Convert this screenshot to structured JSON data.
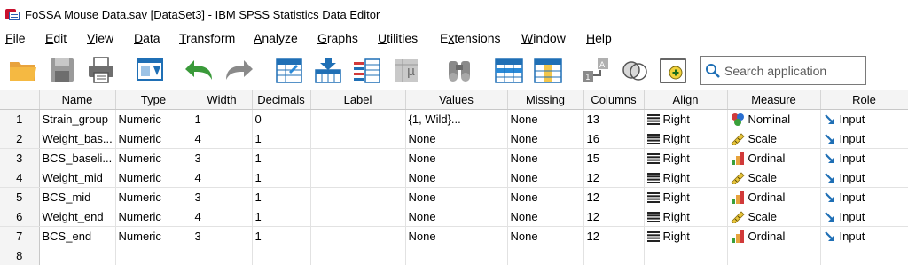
{
  "window": {
    "title": "FoSSA Mouse Data.sav [DataSet3] - IBM SPSS Statistics Data Editor"
  },
  "menu": [
    {
      "label": "File",
      "underline": "F",
      "rest": "ile"
    },
    {
      "label": "Edit",
      "underline": "E",
      "rest": "dit"
    },
    {
      "label": "View",
      "underline": "V",
      "rest": "iew"
    },
    {
      "label": "Data",
      "underline": "D",
      "rest": "ata"
    },
    {
      "label": "Transform",
      "underline": "T",
      "rest": "ransform"
    },
    {
      "label": "Analyze",
      "underline": "A",
      "rest": "nalyze"
    },
    {
      "label": "Graphs",
      "underline": "G",
      "rest": "raphs"
    },
    {
      "label": "Utilities",
      "underline": "U",
      "rest": "tilities"
    },
    {
      "label": "Extensions",
      "underline": "x",
      "pre": "E",
      "rest": "tensions"
    },
    {
      "label": "Window",
      "underline": "W",
      "rest": "indow"
    },
    {
      "label": "Help",
      "underline": "H",
      "rest": "elp"
    }
  ],
  "toolbar": {
    "icons": [
      "open-folder-icon",
      "save-icon",
      "print-icon",
      "dialog-recall-icon",
      "undo-icon",
      "redo-icon",
      "go-to-case-icon",
      "go-to-variable-icon",
      "variables-icon",
      "run-descriptives-icon",
      "find-icon",
      "insert-cases-icon",
      "insert-variable-icon",
      "split-file-icon",
      "select-cases-icon",
      "value-labels-icon",
      "use-variable-sets-icon"
    ],
    "search_placeholder": "Search application"
  },
  "grid": {
    "columns": [
      "Name",
      "Type",
      "Width",
      "Decimals",
      "Label",
      "Values",
      "Missing",
      "Columns",
      "Align",
      "Measure",
      "Role"
    ],
    "rows": [
      {
        "num": "1",
        "name": "Strain_group",
        "type": "Numeric",
        "width": "1",
        "decimals": "0",
        "label": "",
        "values": "{1, Wild}...",
        "missing": "None",
        "columns": "13",
        "align": "Right",
        "measure": "Nominal",
        "measure_icon": "nominal-icon",
        "role": "Input"
      },
      {
        "num": "2",
        "name": "Weight_bas...",
        "type": "Numeric",
        "width": "4",
        "decimals": "1",
        "label": "",
        "values": "None",
        "missing": "None",
        "columns": "16",
        "align": "Right",
        "measure": "Scale",
        "measure_icon": "scale-icon",
        "role": "Input"
      },
      {
        "num": "3",
        "name": "BCS_baseli...",
        "type": "Numeric",
        "width": "3",
        "decimals": "1",
        "label": "",
        "values": "None",
        "missing": "None",
        "columns": "15",
        "align": "Right",
        "measure": "Ordinal",
        "measure_icon": "ordinal-icon",
        "role": "Input"
      },
      {
        "num": "4",
        "name": "Weight_mid",
        "type": "Numeric",
        "width": "4",
        "decimals": "1",
        "label": "",
        "values": "None",
        "missing": "None",
        "columns": "12",
        "align": "Right",
        "measure": "Scale",
        "measure_icon": "scale-icon",
        "role": "Input"
      },
      {
        "num": "5",
        "name": "BCS_mid",
        "type": "Numeric",
        "width": "3",
        "decimals": "1",
        "label": "",
        "values": "None",
        "missing": "None",
        "columns": "12",
        "align": "Right",
        "measure": "Ordinal",
        "measure_icon": "ordinal-icon",
        "role": "Input"
      },
      {
        "num": "6",
        "name": "Weight_end",
        "type": "Numeric",
        "width": "4",
        "decimals": "1",
        "label": "",
        "values": "None",
        "missing": "None",
        "columns": "12",
        "align": "Right",
        "measure": "Scale",
        "measure_icon": "scale-icon",
        "role": "Input"
      },
      {
        "num": "7",
        "name": "BCS_end",
        "type": "Numeric",
        "width": "3",
        "decimals": "1",
        "label": "",
        "values": "None",
        "missing": "None",
        "columns": "12",
        "align": "Right",
        "measure": "Ordinal",
        "measure_icon": "ordinal-icon",
        "role": "Input"
      },
      {
        "num": "8",
        "name": "",
        "type": "",
        "width": "",
        "decimals": "",
        "label": "",
        "values": "",
        "missing": "",
        "columns": "",
        "align": "",
        "measure": "",
        "measure_icon": "",
        "role": ""
      }
    ]
  }
}
